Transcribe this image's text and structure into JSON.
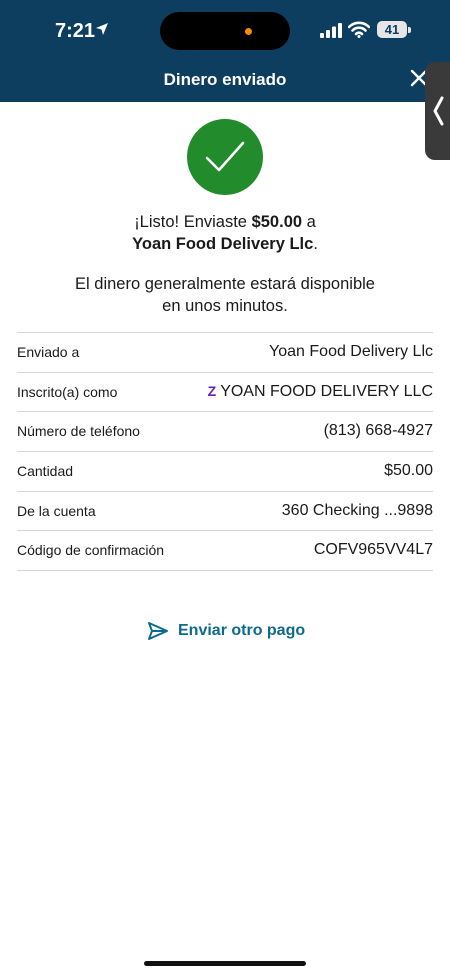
{
  "status_bar": {
    "time": "7:21",
    "battery": "41"
  },
  "header": {
    "title": "Dinero enviado"
  },
  "confirmation": {
    "prefix": "¡Listo! Enviaste ",
    "amount": "$50.00",
    "mid": " a",
    "recipient": "Yoan Food Delivery Llc",
    "suffix": ".",
    "info_line1": "El dinero generalmente estará disponible",
    "info_line2": "en unos minutos."
  },
  "details": [
    {
      "label": "Enviado a",
      "value": "Yoan Food Delivery Llc"
    },
    {
      "label": "Inscrito(a) como",
      "value": "YOAN FOOD DELIVERY LLC"
    },
    {
      "label": "Número de teléfono",
      "value": "(813) 668-4927"
    },
    {
      "label": "Cantidad",
      "value": "$50.00"
    },
    {
      "label": "De la cuenta",
      "value": "360 Checking ...9898"
    },
    {
      "label": "Código de confirmación",
      "value": "COFV965VV4L7"
    }
  ],
  "actions": {
    "send_another": "Enviar otro pago"
  },
  "colors": {
    "header": "#0d3e60",
    "success": "#228b2b",
    "link": "#0e6a8c",
    "zelle": "#6b1fb1"
  },
  "icons": {
    "success": "checkmark-icon",
    "close": "close-icon",
    "send": "paper-plane-icon",
    "zelle": "zelle-icon"
  }
}
